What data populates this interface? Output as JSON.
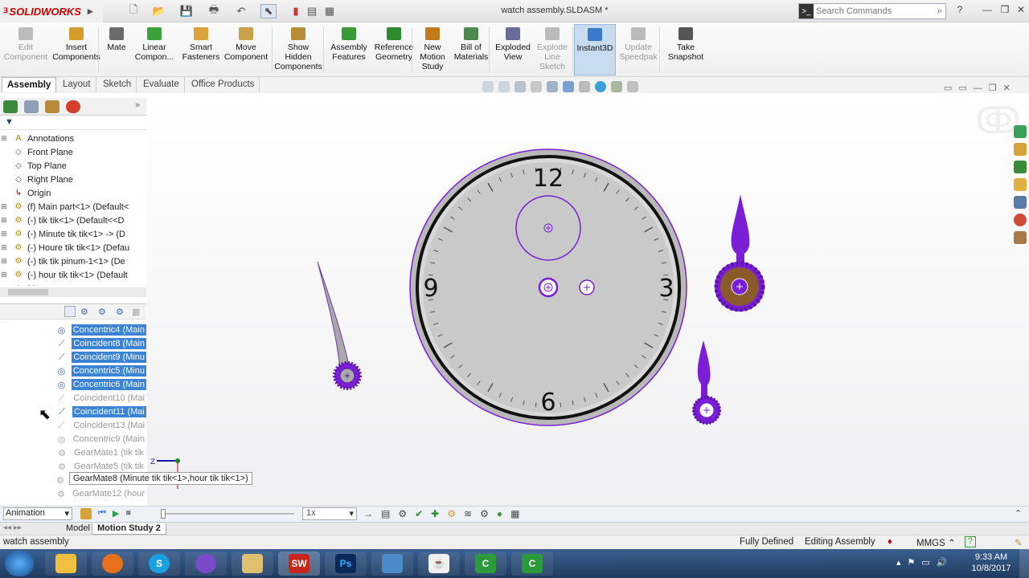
{
  "app": {
    "brand": "SOLIDWORKS",
    "doc_title": "watch assembly.SLDASM *"
  },
  "search": {
    "placeholder": "Search Commands"
  },
  "ribbon": [
    {
      "label": "Edit Component",
      "lines": [
        "Edit",
        "Component"
      ],
      "disabled": true,
      "icon_color": "#bbbbbb"
    },
    {
      "label": "Insert Components",
      "lines": [
        "Insert",
        "Components"
      ],
      "disabled": false,
      "icon_color": "#d59b2c"
    },
    {
      "label": "Mate",
      "lines": [
        "Mate"
      ],
      "disabled": false,
      "icon_color": "#6b6b6b"
    },
    {
      "label": "Linear Component...",
      "lines": [
        "Linear",
        "Compon..."
      ],
      "disabled": false,
      "icon_color": "#3aa33a"
    },
    {
      "label": "Smart Fasteners",
      "lines": [
        "Smart",
        "Fasteners"
      ],
      "disabled": false,
      "icon_color": "#d9a23a"
    },
    {
      "label": "Move Component",
      "lines": [
        "Move",
        "Component"
      ],
      "disabled": false,
      "icon_color": "#c8a04a"
    },
    {
      "label": "Show Hidden Components",
      "lines": [
        "Show",
        "Hidden",
        "Components"
      ],
      "disabled": false,
      "icon_color": "#b88b3a"
    },
    {
      "label": "Assembly Features",
      "lines": [
        "Assembly",
        "Features"
      ],
      "disabled": false,
      "icon_color": "#3a9a3a"
    },
    {
      "label": "Reference Geometry",
      "lines": [
        "Reference",
        "Geometry"
      ],
      "disabled": false,
      "icon_color": "#2e8b2e"
    },
    {
      "label": "New Motion Study",
      "lines": [
        "New",
        "Motion",
        "Study"
      ],
      "disabled": false,
      "icon_color": "#c07a1a"
    },
    {
      "label": "Bill of Materials",
      "lines": [
        "Bill of",
        "Materials"
      ],
      "disabled": false,
      "icon_color": "#4a8a4a"
    },
    {
      "label": "Exploded View",
      "lines": [
        "Exploded",
        "View"
      ],
      "disabled": false,
      "icon_color": "#6a6a9a"
    },
    {
      "label": "Explode Line Sketch",
      "lines": [
        "Explode",
        "Line",
        "Sketch"
      ],
      "disabled": true,
      "icon_color": "#bbbbbb"
    },
    {
      "label": "Instant3D",
      "lines": [
        "Instant3D"
      ],
      "disabled": false,
      "active": true,
      "icon_color": "#3a7ac8"
    },
    {
      "label": "Update Speedpak",
      "lines": [
        "Update",
        "Speedpak"
      ],
      "disabled": true,
      "icon_color": "#bbbbbb"
    },
    {
      "label": "Take Snapshot",
      "lines": [
        "Take",
        "Snapshot"
      ],
      "disabled": false,
      "icon_color": "#555555"
    }
  ],
  "cmd_tabs": [
    "Assembly",
    "Layout",
    "Sketch",
    "Evaluate",
    "Office Products"
  ],
  "tree": [
    {
      "label": "Annotations",
      "icon": "annotations-icon",
      "expander": "+"
    },
    {
      "label": "Front Plane",
      "icon": "plane-icon",
      "expander": ""
    },
    {
      "label": "Top Plane",
      "icon": "plane-icon",
      "expander": ""
    },
    {
      "label": "Right Plane",
      "icon": "plane-icon",
      "expander": ""
    },
    {
      "label": "Origin",
      "icon": "origin-icon",
      "expander": ""
    },
    {
      "label": "(f) Main part<1> (Default<",
      "icon": "part-icon",
      "expander": "+"
    },
    {
      "label": "(-) tik tik<1> (Default<<D",
      "icon": "part-icon",
      "expander": "+"
    },
    {
      "label": "(-) Minute tik tik<1> -> (D",
      "icon": "part-icon",
      "expander": "+"
    },
    {
      "label": "(-) Houre tik tik<1> (Defau",
      "icon": "part-icon",
      "expander": "+"
    },
    {
      "label": "(-) tik tik pinum-1<1> (De",
      "icon": "part-icon",
      "expander": "+"
    },
    {
      "label": "(-) hour tik tik<1> (Default",
      "icon": "part-icon",
      "expander": "+"
    },
    {
      "label": "Mates",
      "icon": "mates-icon",
      "expander": "-"
    }
  ],
  "mates": [
    {
      "label": "Concentric4 (Main",
      "type": "concentric",
      "state": "selected"
    },
    {
      "label": "Coincident8 (Main",
      "type": "coincident",
      "state": "selected"
    },
    {
      "label": "Coincident9 (Minu",
      "type": "coincident",
      "state": "selected"
    },
    {
      "label": "Concentric5 (Minu",
      "type": "concentric",
      "state": "selected"
    },
    {
      "label": "Concentric6 (Main",
      "type": "concentric",
      "state": "selected"
    },
    {
      "label": "Coincident10 (Mai",
      "type": "coincident",
      "state": "disabled"
    },
    {
      "label": "Coincident11 (Mai",
      "type": "coincident",
      "state": "selected"
    },
    {
      "label": "Coincident13 (Mai",
      "type": "coincident",
      "state": "disabled"
    },
    {
      "label": "Concentric9 (Main",
      "type": "concentric",
      "state": "disabled"
    },
    {
      "label": "GearMate1 (tik tik",
      "type": "gear",
      "state": "disabled"
    },
    {
      "label": "GearMate5 (tik tik",
      "type": "gear",
      "state": "disabled"
    },
    {
      "label": "GearMate8 (Minute",
      "type": "gear",
      "state": "disabled"
    },
    {
      "label": "GearMate12 (hour",
      "type": "gear",
      "state": "disabled"
    }
  ],
  "tooltip": "GearMate8 (Minute tik tik<1>,hour tik tik<1>)",
  "watch": {
    "numerals": {
      "top": "12",
      "right": "3",
      "bottom": "6",
      "left": "9"
    }
  },
  "triad": {
    "z_label": "Z"
  },
  "motion": {
    "mode": "Animation",
    "speed": "1x"
  },
  "bottom_tabs": [
    "Model",
    "Motion Study 2"
  ],
  "status": {
    "left": "watch assembly",
    "fully_defined": "Fully Defined",
    "editing": "Editing Assembly",
    "units": "MMGS"
  },
  "clock": {
    "time": "9:33 AM",
    "date": "10/8/2017"
  },
  "colors": {
    "accent": "#7a1fd6",
    "gear_brown": "#8b5a2b",
    "dial": "#c9c9c9"
  }
}
